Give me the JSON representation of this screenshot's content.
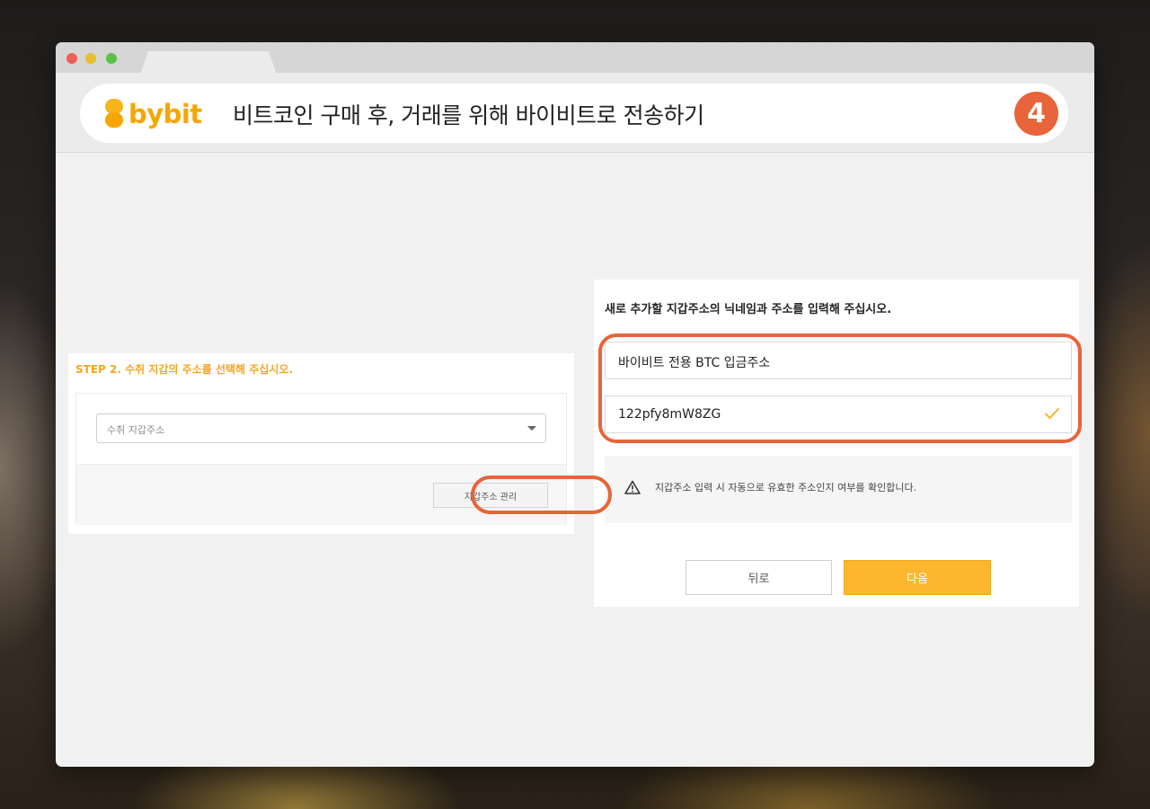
{
  "header": {
    "logo_text": "bybit",
    "title": "비트코인 구매 후, 거래를 위해 바이비트로 전송하기",
    "step_number": "4"
  },
  "left_panel": {
    "step_label": "STEP 2. 수취 지갑의 주소를 선택해 주십시오.",
    "select_placeholder": "수취 지갑주소",
    "manage_button": "지갑주소 관리"
  },
  "right_panel": {
    "heading": "새로 추가할 지갑주소의 닉네임과 주소를 입력해 주십시오.",
    "nickname_value": "바이비트 전용 BTC 입금주소",
    "address_value": "122pfy8mW8ZG",
    "notice": "지갑주소 입력 시 자동으로 유효한 주소인지 여부를 확인합니다.",
    "back_button": "뒤로",
    "next_button": "다음"
  },
  "colors": {
    "brand": "#f7a600",
    "accent_highlight": "#e8643a",
    "next_button": "#fcb72e",
    "valid_check": "#f5b82e"
  }
}
